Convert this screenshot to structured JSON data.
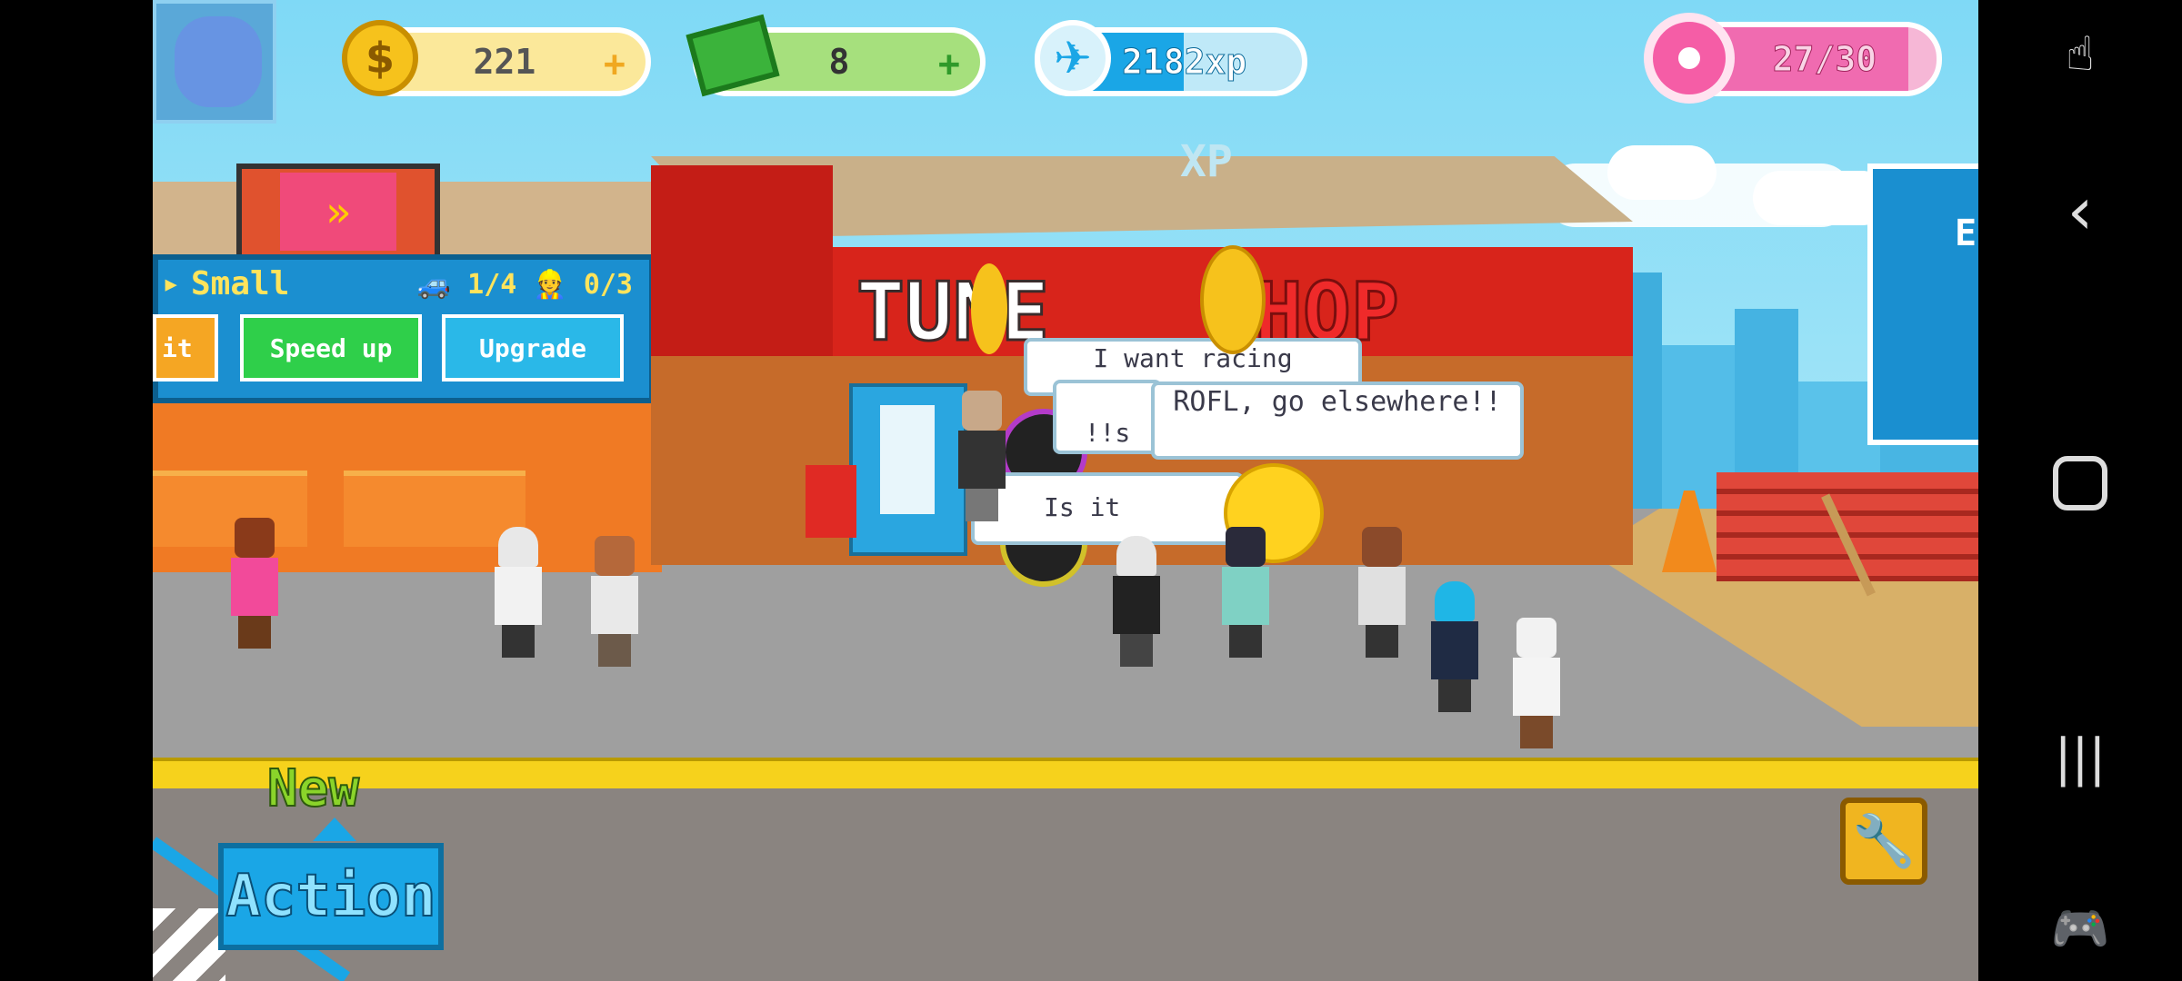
{
  "hud": {
    "coins": "221",
    "cash": "8",
    "xp": "2182xp",
    "xp_progress": 0.55,
    "donuts": "27/30",
    "plus": "+"
  },
  "floating_xp": "XP",
  "shop": {
    "sign_left": "TUNE",
    "sign_right": "SHOP"
  },
  "garage_panel": {
    "title": "Small",
    "cars": "1/4",
    "workers": "0/3",
    "buttons": [
      {
        "label": "it"
      },
      {
        "label": "Speed up"
      },
      {
        "label": "Upgrade"
      }
    ]
  },
  "bubbles": [
    {
      "text": "I want racing"
    },
    {
      "text": "ROFL, go elsewhere!!"
    },
    {
      "text": "Is it"
    },
    {
      "text": "!!s"
    }
  ],
  "new_action": {
    "new_label": "New",
    "action_label": "Action"
  },
  "side_board_letter": "E",
  "colors": {
    "sky": "#7fd9f6",
    "coin_pill": "#fbe89a",
    "cash_pill": "#a6e07d",
    "xp_pill": "#1aa6e6",
    "donut_pill": "#f06bb0",
    "panel": "#1b8fd0",
    "speed_btn": "#2fcf4a",
    "upgrade_btn": "#2ab8e8",
    "curb": "#f6d21c"
  },
  "icons": {
    "coin": "dollar-coin-icon",
    "cash": "cash-bill-icon",
    "xp": "plane-icon",
    "donut": "donut-icon",
    "wrench": "wrench-icon"
  }
}
